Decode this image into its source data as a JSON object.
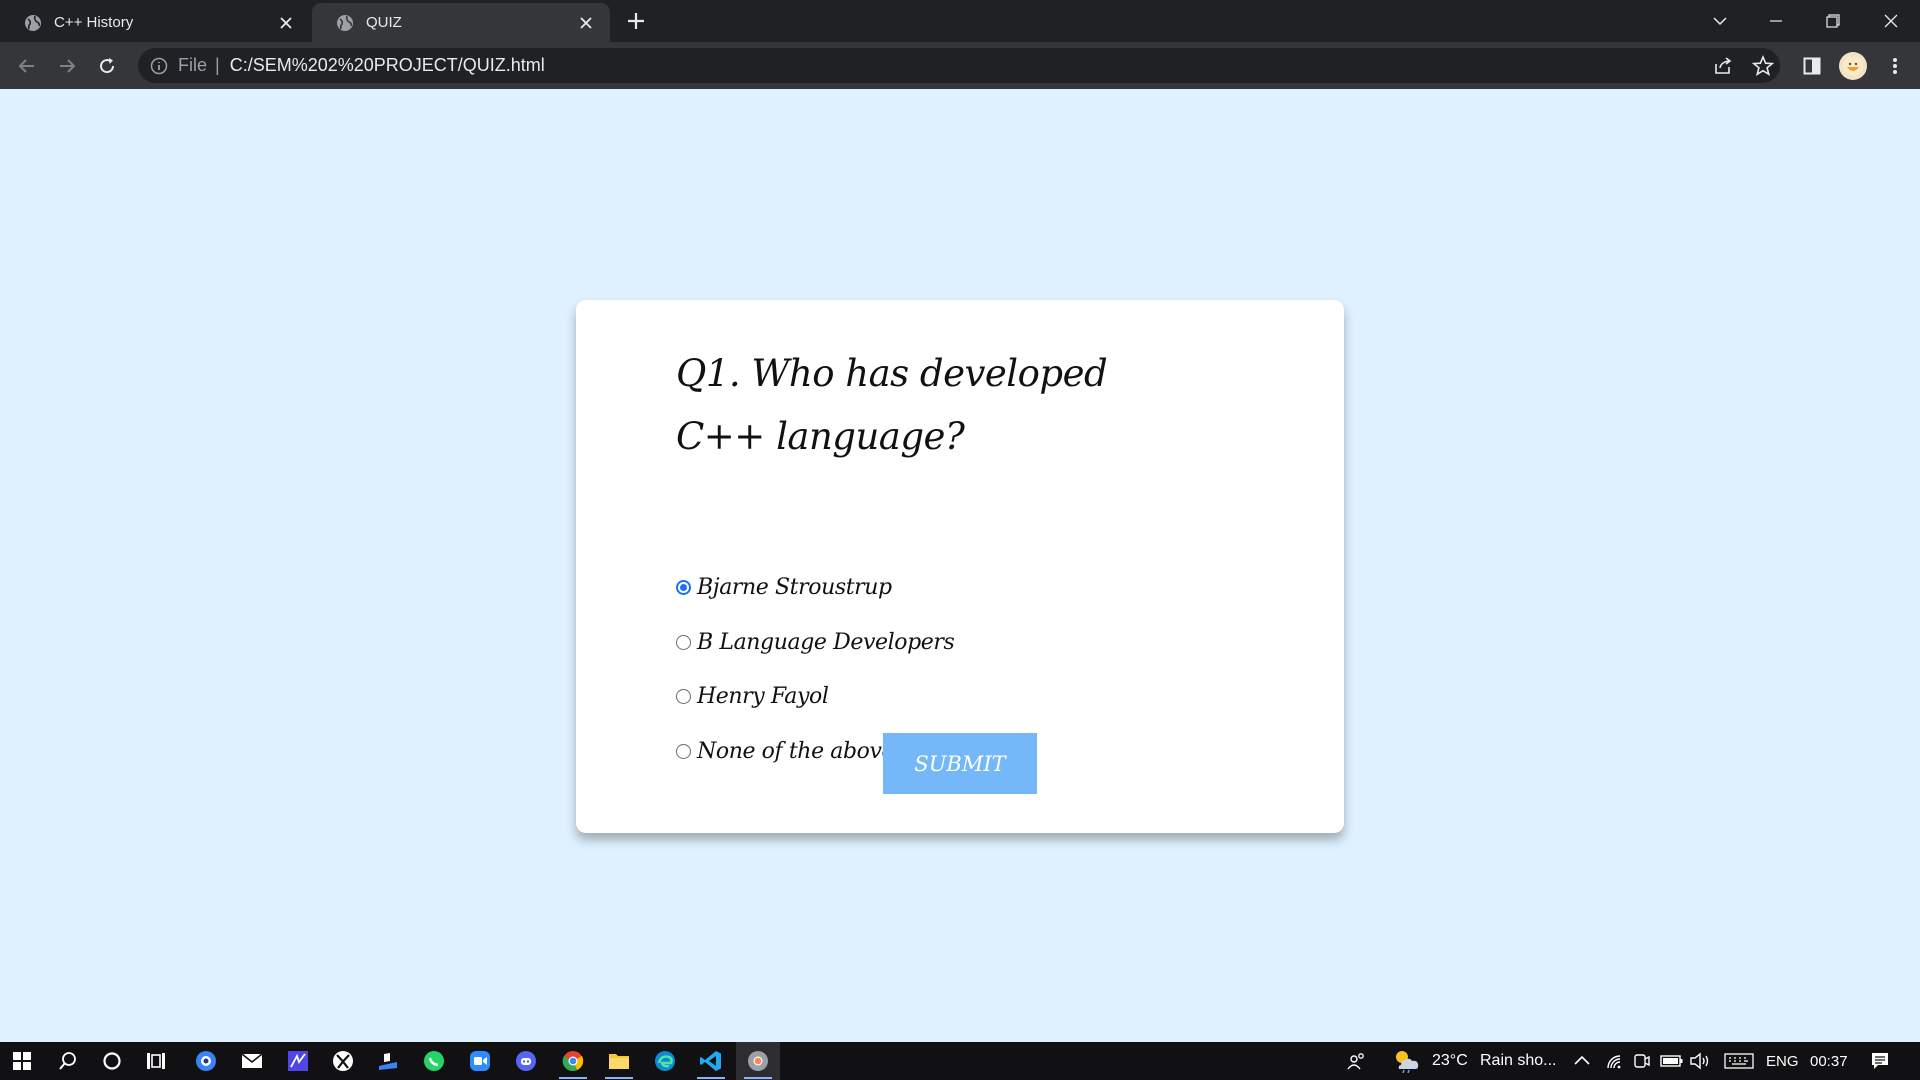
{
  "browser": {
    "tabs": [
      {
        "title": "C++ History",
        "active": false
      },
      {
        "title": "QUIZ",
        "active": true
      }
    ],
    "address": {
      "scheme_label": "File",
      "url": "C:/SEM%202%20PROJECT/QUIZ.html"
    }
  },
  "quiz": {
    "question": "Q1. Who has developed C++ language?",
    "options": [
      {
        "label": "Bjarne Stroustrup",
        "selected": true
      },
      {
        "label": "B Language Developers",
        "selected": false
      },
      {
        "label": "Henry Fayol",
        "selected": false
      },
      {
        "label": "None of the above.",
        "selected": false
      }
    ],
    "submit_label": "SUBMIT"
  },
  "taskbar": {
    "weather": {
      "temp": "23°C",
      "condition": "Rain sho..."
    },
    "language": "ENG",
    "time": "00:37"
  },
  "colors": {
    "page_bg": "#dff0fe",
    "card_bg": "#ffffff",
    "submit_bg": "#75b8fa",
    "radio_accent": "#1a73e8"
  }
}
